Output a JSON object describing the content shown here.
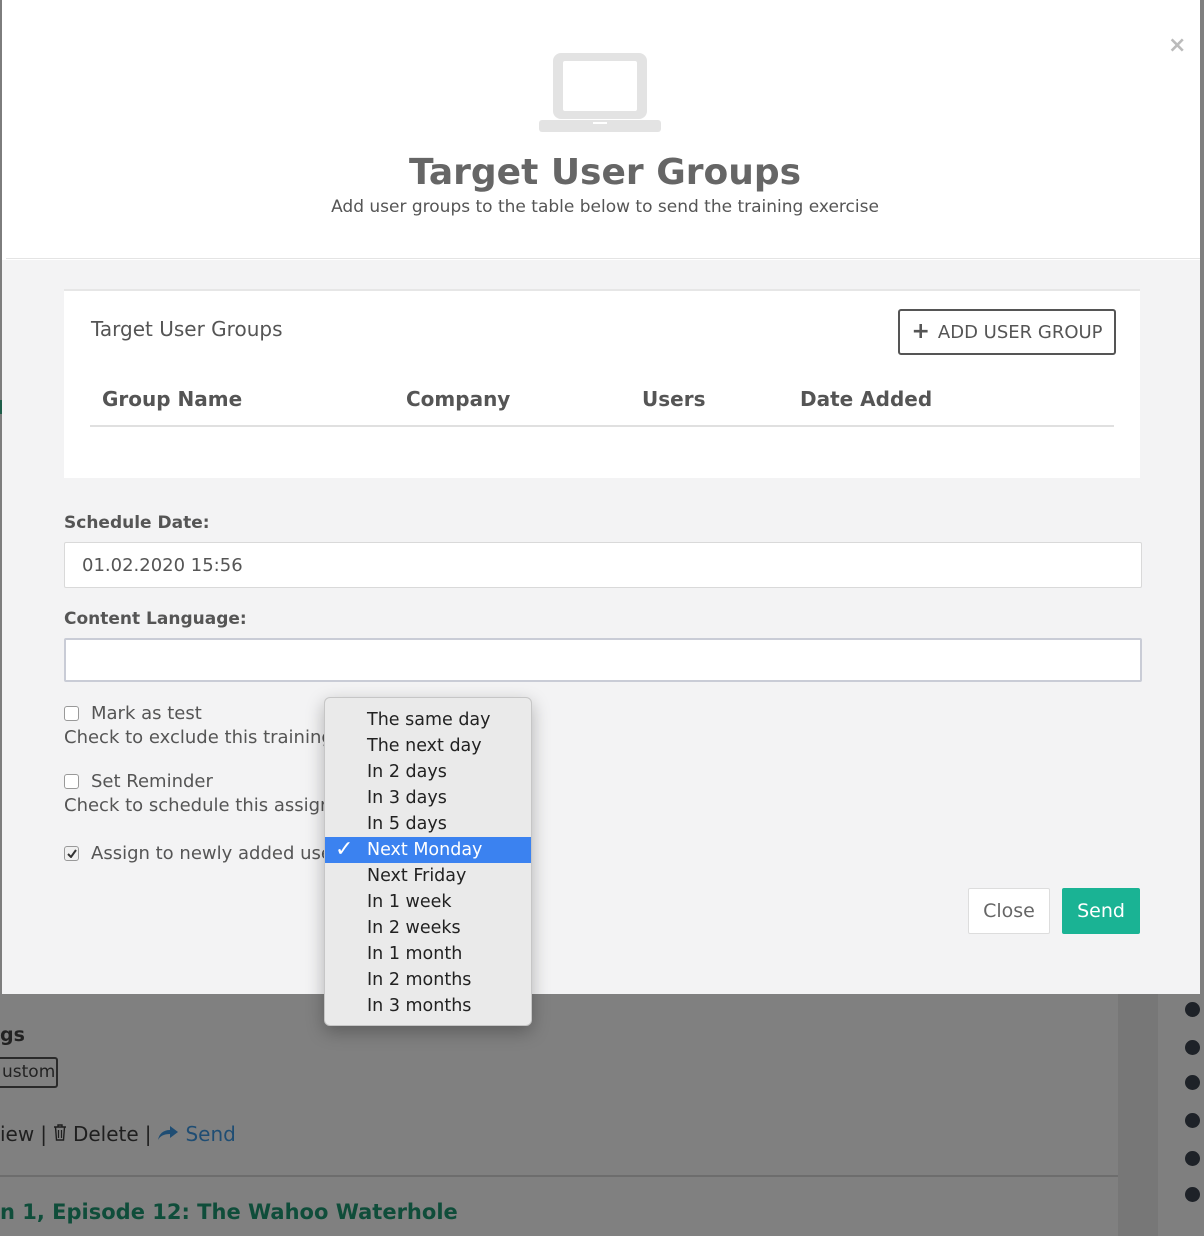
{
  "modal": {
    "close_symbol": "×",
    "header_icon": "laptop-icon",
    "title": "Target User Groups",
    "subtitle": "Add user groups to the table below to send the training exercise"
  },
  "group_panel": {
    "title": "Target User Groups",
    "add_button_icon": "plus-icon",
    "add_button_label": "ADD USER GROUP",
    "columns": [
      "Group Name",
      "Company",
      "Users",
      "Date Added"
    ],
    "rows": []
  },
  "schedule": {
    "label": "Schedule Date:",
    "value": "01.02.2020 15:56"
  },
  "language": {
    "label": "Content Language:",
    "value": ""
  },
  "options": {
    "mark_as_test": {
      "label": "Mark as test",
      "checked": false,
      "help": "Check to exclude this training fr"
    },
    "set_reminder": {
      "label": "Set Reminder",
      "checked": false,
      "help": "Check to schedule this assignm"
    },
    "assign_new_users": {
      "label": "Assign to newly added users",
      "checked": true
    }
  },
  "footer": {
    "close_label": "Close",
    "send_label": "Send",
    "send_color": "#1ab394"
  },
  "dropdown": {
    "selected": "Next Monday",
    "check_symbol": "✓",
    "options": [
      "The same day",
      "The next day",
      "In 2 days",
      "In 3 days",
      "In 5 days",
      "Next Monday",
      "Next Friday",
      "In 1 week",
      "In 2 weeks",
      "In 1 month",
      "In 2 months",
      "In 3 months"
    ]
  },
  "background": {
    "settings_label": "gs",
    "custom_button": "ustom",
    "actions": {
      "view": "iew",
      "separator": "|",
      "delete": "Delete",
      "send": "Send"
    },
    "episode_title": "n 1, Episode 12: The Wahoo Waterhole"
  }
}
